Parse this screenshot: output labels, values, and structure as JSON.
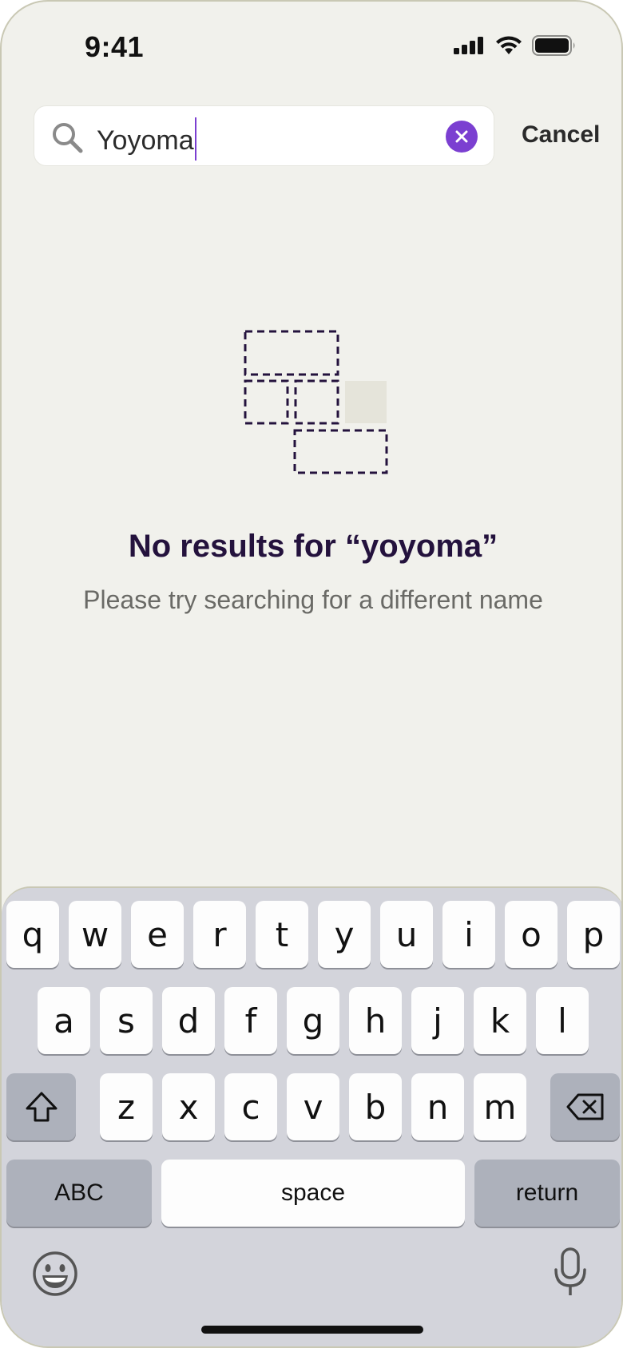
{
  "status_bar": {
    "time": "9:41",
    "icons": [
      "cellular-signal-icon",
      "wifi-icon",
      "battery-icon"
    ]
  },
  "search": {
    "value": "Yoyoma",
    "icon": "search-icon",
    "clear_icon": "clear-icon",
    "cancel_label": "Cancel",
    "accent_color": "#7b3fd1"
  },
  "empty_state": {
    "illustration": "empty-results-placeholder-illustration",
    "title": "No results for “yoyoma”",
    "subtitle": "Please try searching for a different name"
  },
  "keyboard": {
    "row1": [
      "q",
      "w",
      "e",
      "r",
      "t",
      "y",
      "u",
      "i",
      "o",
      "p"
    ],
    "row2": [
      "a",
      "s",
      "d",
      "f",
      "g",
      "h",
      "j",
      "k",
      "l"
    ],
    "row3": [
      "z",
      "x",
      "c",
      "v",
      "b",
      "n",
      "m"
    ],
    "shift_icon": "shift-icon",
    "delete_icon": "backspace-icon",
    "abc_label": "ABC",
    "space_label": "space",
    "return_label": "return",
    "emoji_icon": "emoji-icon",
    "mic_icon": "microphone-icon"
  }
}
